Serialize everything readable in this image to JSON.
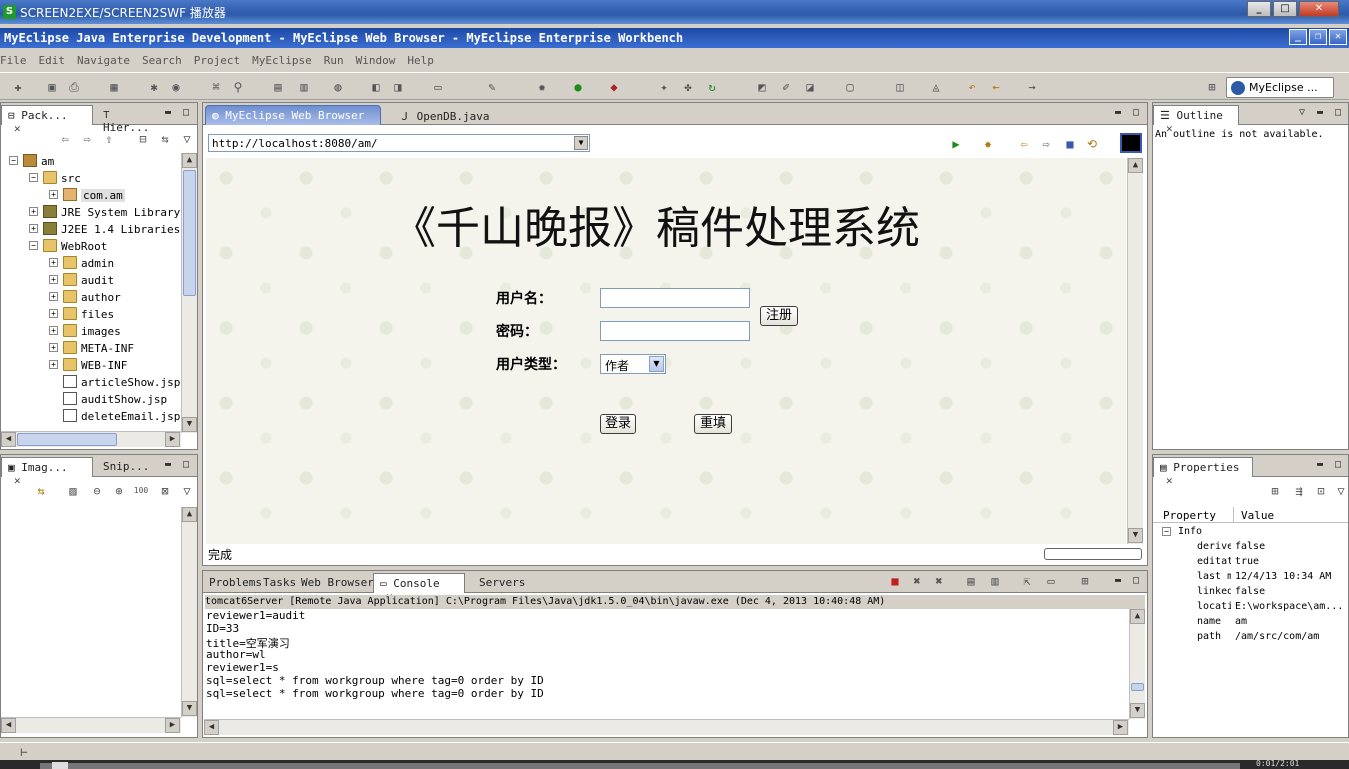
{
  "player": {
    "title": "SCREEN2EXE/SCREEN2SWF 播放器",
    "time": "0:01/2:01"
  },
  "ide": {
    "title": "MyEclipse Java Enterprise Development - MyEclipse Web Browser - MyEclipse Enterprise Workbench"
  },
  "menu": [
    "File",
    "Edit",
    "Navigate",
    "Search",
    "Project",
    "MyEclipse",
    "Run",
    "Window",
    "Help"
  ],
  "perspective": {
    "label": "MyEclipse ..."
  },
  "package_explorer": {
    "tabs": [
      "Pack...",
      "Hier..."
    ],
    "tree": [
      {
        "label": "am",
        "indent": 0,
        "icon": "proj",
        "exp": "−"
      },
      {
        "label": "src",
        "indent": 1,
        "icon": "folder",
        "exp": "−"
      },
      {
        "label": "com.am",
        "indent": 2,
        "icon": "pkg",
        "exp": "+"
      },
      {
        "label": "JRE System Library",
        "indent": 1,
        "icon": "lib",
        "exp": "+"
      },
      {
        "label": "J2EE 1.4 Libraries",
        "indent": 1,
        "icon": "lib",
        "exp": "+"
      },
      {
        "label": "WebRoot",
        "indent": 1,
        "icon": "folder",
        "exp": "−"
      },
      {
        "label": "admin",
        "indent": 2,
        "icon": "folder",
        "exp": "+"
      },
      {
        "label": "audit",
        "indent": 2,
        "icon": "folder",
        "exp": "+"
      },
      {
        "label": "author",
        "indent": 2,
        "icon": "folder",
        "exp": "+"
      },
      {
        "label": "files",
        "indent": 2,
        "icon": "folder",
        "exp": "+"
      },
      {
        "label": "images",
        "indent": 2,
        "icon": "folder",
        "exp": "+"
      },
      {
        "label": "META-INF",
        "indent": 2,
        "icon": "folder",
        "exp": "+"
      },
      {
        "label": "WEB-INF",
        "indent": 2,
        "icon": "folder",
        "exp": "+"
      },
      {
        "label": "articleShow.jsp",
        "indent": 2,
        "icon": "jsp",
        "exp": ""
      },
      {
        "label": "auditShow.jsp",
        "indent": 2,
        "icon": "jsp",
        "exp": ""
      },
      {
        "label": "deleteEmail.jsp",
        "indent": 2,
        "icon": "jsp",
        "exp": ""
      }
    ]
  },
  "image_panel": {
    "tabs": [
      "Imag...",
      "Snip..."
    ]
  },
  "editor": {
    "tabs": [
      "MyEclipse Web Browser",
      "OpenDB.java"
    ],
    "url": "http://localhost:8080/am/",
    "status": "完成",
    "page": {
      "title": "《千山晚报》稿件处理系统",
      "username_label": "用户名：",
      "password_label": "密码：",
      "usertype_label": "用户类型：",
      "usertype_value": "作者",
      "register_button": "注册",
      "login_button": "登录",
      "reset_button": "重填"
    }
  },
  "outline": {
    "tab": "Outline",
    "message": "An outline is not available."
  },
  "properties": {
    "tab": "Properties",
    "columns": [
      "Property",
      "Value"
    ],
    "group": "Info",
    "rows": [
      {
        "k": "derive",
        "v": "false"
      },
      {
        "k": "editat",
        "v": "true"
      },
      {
        "k": "last m",
        "v": "12/4/13 10:34 AM"
      },
      {
        "k": "linked",
        "v": "false"
      },
      {
        "k": "locati",
        "v": "E:\\workspace\\am..."
      },
      {
        "k": "name",
        "v": "am"
      },
      {
        "k": "path",
        "v": "/am/src/com/am"
      }
    ]
  },
  "bottom": {
    "tabs": [
      "Problems",
      "Tasks",
      "Web Browser",
      "Console",
      "Servers"
    ],
    "header": "tomcat6Server [Remote Java Application] C:\\Program Files\\Java\\jdk1.5.0_04\\bin\\javaw.exe (Dec 4, 2013 10:40:48 AM)",
    "lines": [
      "reviewer1=audit",
      "ID=33",
      "title=空军演习",
      "author=wl",
      "reviewer1=s",
      "sql=select * from workgroup where tag=0 order by ID",
      "sql=select * from workgroup where tag=0 order by ID"
    ]
  },
  "colors": {
    "ide_title": "#1e4aa6",
    "player_title": "#2c5aa8",
    "chrome": "#d4d0c8"
  }
}
